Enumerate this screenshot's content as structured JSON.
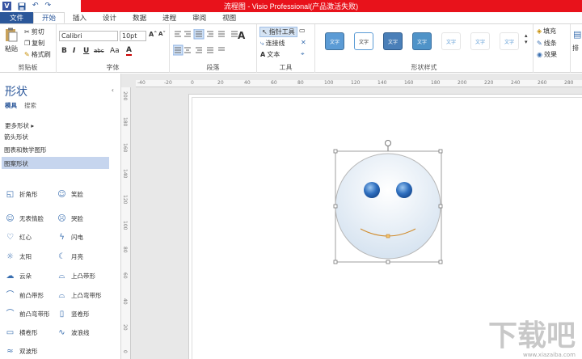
{
  "window": {
    "title": "流程图 - Visio Professional(产品激活失败)"
  },
  "qat": {
    "logo": "V",
    "undo": "↶",
    "redo": "↷"
  },
  "tabs": [
    "文件",
    "开始",
    "插入",
    "设计",
    "数据",
    "进程",
    "审阅",
    "视图"
  ],
  "ribbon": {
    "clipboard": {
      "paste": "粘贴",
      "cut": "剪切",
      "copy": "复制",
      "format_painter": "格式刷",
      "label": "剪贴板"
    },
    "font": {
      "name": "Calibri",
      "size": "10pt",
      "bold": "B",
      "italic": "I",
      "underline": "U",
      "strike": "abc",
      "case": "Aa",
      "color": "A",
      "grow": "Aˆ",
      "shrink": "Aˇ",
      "label": "字体"
    },
    "paragraph": {
      "label": "段落"
    },
    "tools": {
      "pointer": "指针工具",
      "connector": "连接线",
      "text": "文本",
      "label": "工具"
    },
    "styles": {
      "swatch_text": "文字",
      "label": "形状样式",
      "fill": "填充",
      "line": "线条",
      "effects": "效果"
    },
    "arrange": {
      "label": "排"
    }
  },
  "shapes_panel": {
    "title": "形状",
    "tab_stencils": "模具",
    "tab_search": "搜索",
    "more_shapes": "更多形状",
    "stencils": [
      "箭头形状",
      "图表和数学图形",
      "图案形状"
    ],
    "selected_stencil": "图案形状",
    "items": [
      {
        "label": "折角形",
        "icon": "folded-corner-icon"
      },
      {
        "label": "笑脸",
        "icon": "smiley-icon"
      },
      {
        "label": "无表情脸",
        "icon": "neutral-face-icon"
      },
      {
        "label": "哭脸",
        "icon": "sad-face-icon"
      },
      {
        "label": "红心",
        "icon": "heart-icon"
      },
      {
        "label": "闪电",
        "icon": "lightning-icon"
      },
      {
        "label": "太阳",
        "icon": "sun-icon"
      },
      {
        "label": "月亮",
        "icon": "moon-icon"
      },
      {
        "label": "云朵",
        "icon": "cloud-icon"
      },
      {
        "label": "上凸带形",
        "icon": "ribbon-up-icon"
      },
      {
        "label": "前凸带形",
        "icon": "ribbon-front-icon"
      },
      {
        "label": "上凸弯带形",
        "icon": "curved-ribbon-up-icon"
      },
      {
        "label": "前凸弯带形",
        "icon": "curved-ribbon-front-icon"
      },
      {
        "label": "竖卷形",
        "icon": "vertical-scroll-icon"
      },
      {
        "label": "横卷形",
        "icon": "horizontal-scroll-icon"
      },
      {
        "label": "波浪线",
        "icon": "wave-icon"
      },
      {
        "label": "双波形",
        "icon": "double-wave-icon"
      }
    ]
  },
  "rulers": {
    "h": [
      "-40",
      "-20",
      "0",
      "20",
      "40",
      "60",
      "80",
      "100",
      "120",
      "140",
      "160",
      "180",
      "200",
      "220",
      "240",
      "260",
      "280"
    ],
    "v": [
      "200",
      "180",
      "160",
      "140",
      "120",
      "100",
      "80",
      "60",
      "40",
      "20",
      "0"
    ]
  },
  "watermark": {
    "text": "下载吧",
    "url": "www.xiazaiba.com"
  }
}
